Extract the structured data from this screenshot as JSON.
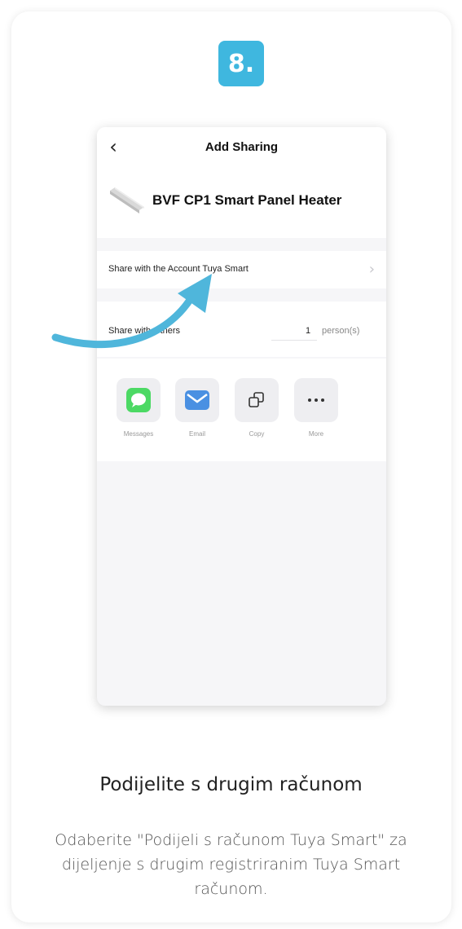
{
  "step": {
    "label": "8."
  },
  "phone": {
    "title": "Add Sharing",
    "back_icon": "chevron-left-icon",
    "device_name": "BVF CP1 Smart Panel Heater",
    "share_account_label": "Share with the Account Tuya Smart",
    "share_others_label": "Share with Others",
    "share_others_count": "1",
    "share_others_unit": "person(s)",
    "share_options": [
      {
        "label": "Messages",
        "icon": "message-icon"
      },
      {
        "label": "Email",
        "icon": "mail-icon"
      },
      {
        "label": "Copy",
        "icon": "copy-icon"
      },
      {
        "label": "More",
        "icon": "more-icon"
      }
    ]
  },
  "caption": {
    "title": "Podijelite s drugim računom",
    "text": "Odaberite \"Podijeli s računom Tuya Smart\" za dijeljenje s drugim registriranim Tuya Smart računom."
  },
  "colors": {
    "accent": "#3fb7df",
    "messages_green": "#4cd964",
    "email_blue": "#4a90e2",
    "arrow": "#4fb6db"
  }
}
